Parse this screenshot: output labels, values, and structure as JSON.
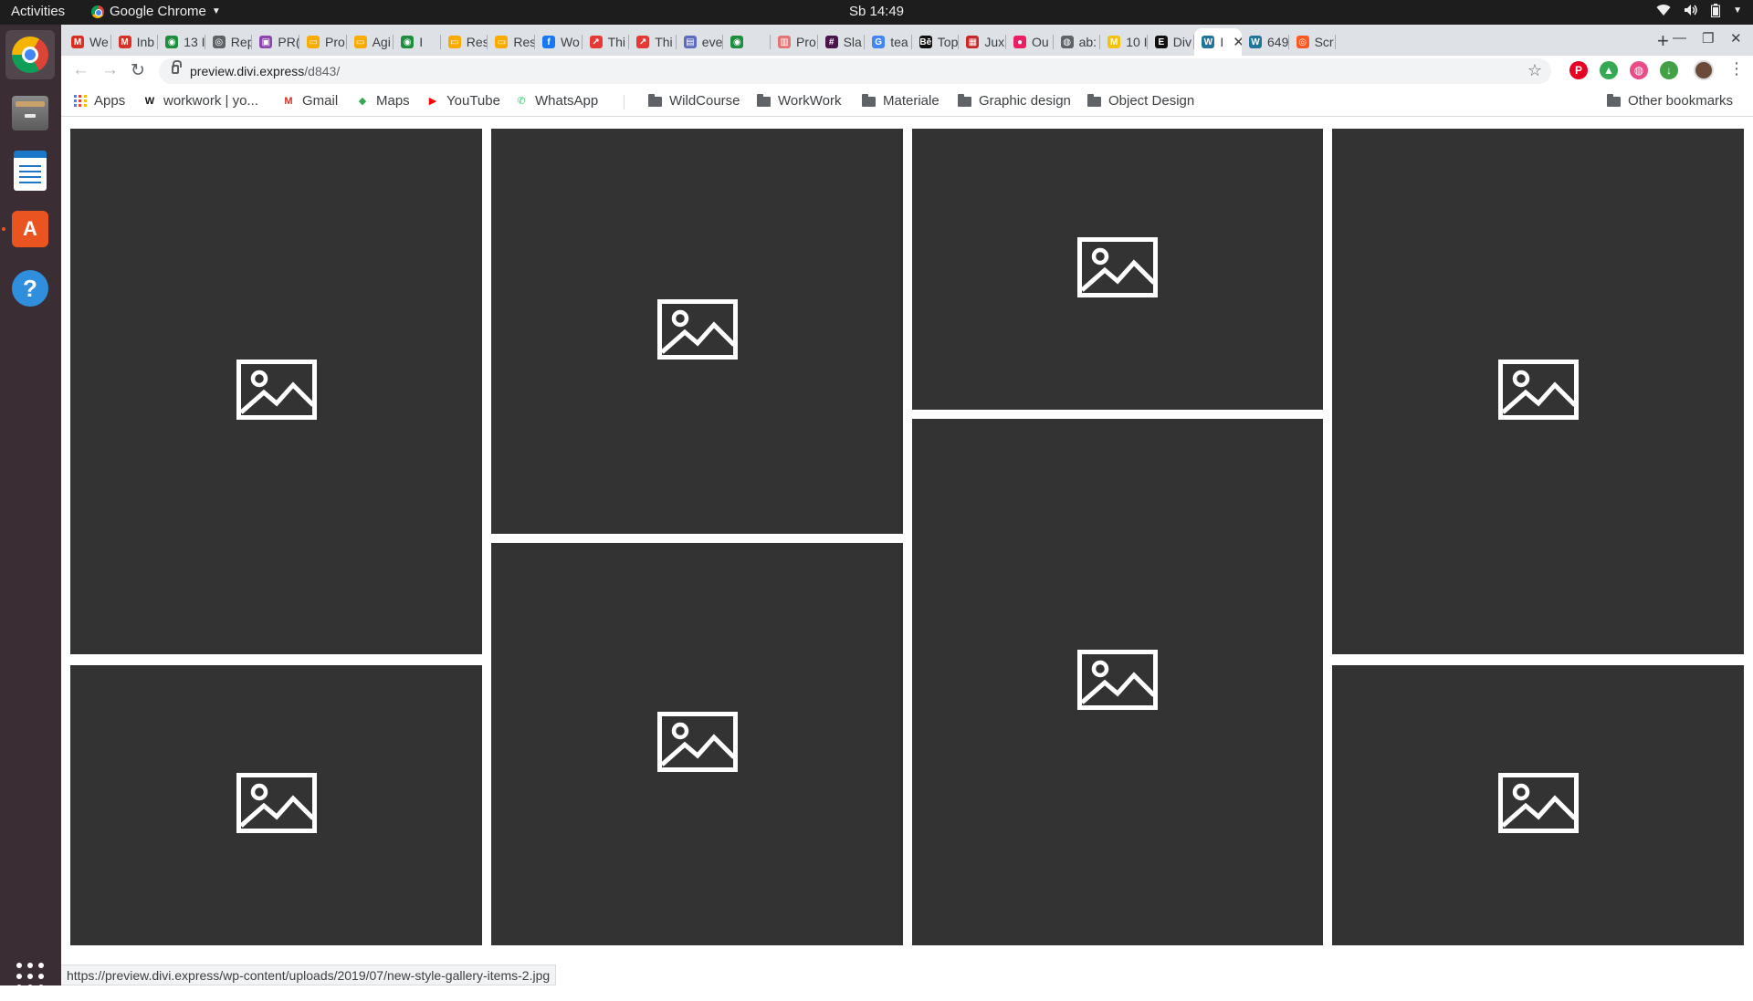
{
  "system": {
    "activities": "Activities",
    "app_name": "Google Chrome",
    "clock": "Sb 14:49"
  },
  "dock": {
    "items": [
      {
        "name": "Google Chrome",
        "icon": "chrome-icon",
        "running": true
      },
      {
        "name": "Files",
        "icon": "files-icon",
        "running": false
      },
      {
        "name": "LibreOffice Writer",
        "icon": "writer-icon",
        "running": false
      },
      {
        "name": "Ubuntu Software",
        "icon": "store-icon",
        "running": true
      },
      {
        "name": "Help",
        "icon": "help-icon",
        "running": false
      }
    ],
    "show_apps_icon": "app-grid-icon"
  },
  "tabs": [
    {
      "label": "We",
      "favicon": "M",
      "color": "#d93025"
    },
    {
      "label": "Inb",
      "favicon": "M",
      "color": "#d93025"
    },
    {
      "label": "13 I",
      "favicon": "◉",
      "color": "#1e8e3e"
    },
    {
      "label": "Rep",
      "favicon": "◎",
      "color": "#5f6368"
    },
    {
      "label": "PR(",
      "favicon": "▣",
      "color": "#8e44ad"
    },
    {
      "label": "Pro",
      "favicon": "▭",
      "color": "#f9ab00"
    },
    {
      "label": "Agi",
      "favicon": "▭",
      "color": "#f9ab00"
    },
    {
      "label": "I",
      "favicon": "◉",
      "color": "#1e8e3e"
    },
    {
      "label": "Res",
      "favicon": "▭",
      "color": "#f9ab00"
    },
    {
      "label": "Res",
      "favicon": "▭",
      "color": "#f9ab00"
    },
    {
      "label": "Wo",
      "favicon": "f",
      "color": "#1877f2"
    },
    {
      "label": "Thi",
      "favicon": "↗",
      "color": "#e53935"
    },
    {
      "label": "Thi",
      "favicon": "↗",
      "color": "#e53935"
    },
    {
      "label": "eve",
      "favicon": "▤",
      "color": "#5c6bc0"
    },
    {
      "label": "",
      "favicon": "◉",
      "color": "#1e8e3e"
    },
    {
      "label": "Pro",
      "favicon": "▥",
      "color": "#e57373"
    },
    {
      "label": "Sla",
      "favicon": "#",
      "color": "#4a154b"
    },
    {
      "label": "tea",
      "favicon": "G",
      "color": "#4285f4"
    },
    {
      "label": "Top",
      "favicon": "Bē",
      "color": "#111111"
    },
    {
      "label": "Jux",
      "favicon": "▦",
      "color": "#c62828"
    },
    {
      "label": "Ou",
      "favicon": "●",
      "color": "#e91e63"
    },
    {
      "label": "ab:",
      "favicon": "◍",
      "color": "#5f6368"
    },
    {
      "label": "10 I",
      "favicon": "M",
      "color": "#f4c20d"
    },
    {
      "label": "Div",
      "favicon": "E",
      "color": "#111111"
    },
    {
      "label": "I",
      "favicon": "W",
      "color": "#21759b",
      "active": true
    },
    {
      "label": "649",
      "favicon": "W",
      "color": "#21759b"
    },
    {
      "label": "Scr",
      "favicon": "◎",
      "color": "#ff5722"
    }
  ],
  "toolbar": {
    "url_host": "preview.divi.express",
    "url_path": "/d843/",
    "extensions": [
      {
        "name": "pinterest-extension",
        "glyph": "P",
        "color": "#e60023"
      },
      {
        "name": "google-drive-extension",
        "glyph": "▲",
        "color": "#34a853"
      },
      {
        "name": "dribbble-extension",
        "glyph": "◍",
        "color": "#ea4c89"
      },
      {
        "name": "download-extension",
        "glyph": "↓",
        "color": "#43a047"
      }
    ]
  },
  "bookmarks": {
    "apps": "Apps",
    "items": [
      {
        "label": "workwork | yo...",
        "icon": "W",
        "color": "#111111"
      },
      {
        "label": "Gmail",
        "icon": "M",
        "color": "#d93025"
      },
      {
        "label": "Maps",
        "icon": "◆",
        "color": "#34a853"
      },
      {
        "label": "YouTube",
        "icon": "▶",
        "color": "#ff0000"
      },
      {
        "label": "WhatsApp",
        "icon": "✆",
        "color": "#25d366"
      }
    ],
    "folders": [
      "WildCourse",
      "WorkWork",
      "Materiale",
      "Graphic design",
      "Object Design"
    ],
    "other": "Other bookmarks"
  },
  "gallery": {
    "tile_color": "#333333",
    "icon_color": "#ffffff",
    "tile_icon": "image-placeholder-icon",
    "tile_count": 8
  },
  "status_bar": {
    "hover_url": "https://preview.divi.express/wp-content/uploads/2019/07/new-style-gallery-items-2.jpg"
  }
}
